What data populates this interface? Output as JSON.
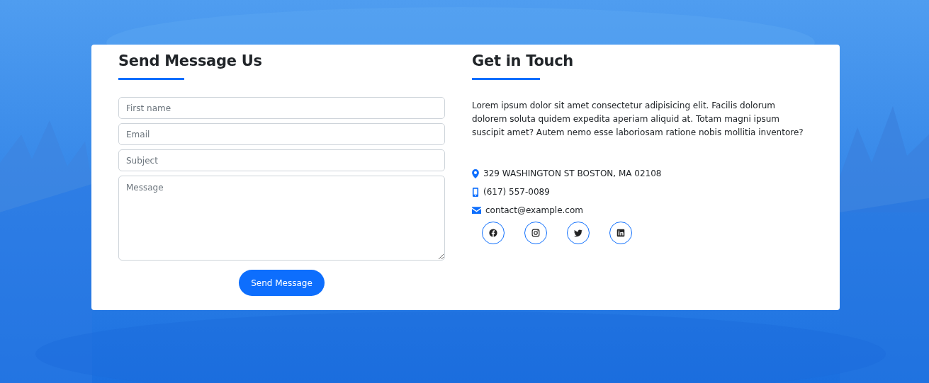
{
  "form": {
    "title": "Send Message Us",
    "fields": [
      {
        "kind": "input",
        "placeholder": "First name"
      },
      {
        "kind": "input",
        "placeholder": "Email"
      },
      {
        "kind": "input",
        "placeholder": "Subject"
      },
      {
        "kind": "textarea",
        "placeholder": "Message"
      }
    ],
    "submit": "Send Message"
  },
  "info": {
    "title": "Get in Touch",
    "text": "Lorem ipsum dolor sit amet consectetur adipisicing elit. Facilis dolorum dolorem soluta quidem expedita aperiam aliquid at. Totam magni ipsum suscipit amet? Autem nemo esse laboriosam ratione nobis mollitia inventore?",
    "contacts": [
      {
        "kind": "address",
        "text": "329 WASHINGTON ST BOSTON, MA 02108"
      },
      {
        "kind": "phone",
        "text": "(617) 557-0089"
      },
      {
        "kind": "email",
        "text": "contact@example.com"
      }
    ],
    "social": [
      {
        "kind": "facebook"
      },
      {
        "kind": "instagram"
      },
      {
        "kind": "twitter"
      },
      {
        "kind": "linkedin"
      }
    ]
  }
}
